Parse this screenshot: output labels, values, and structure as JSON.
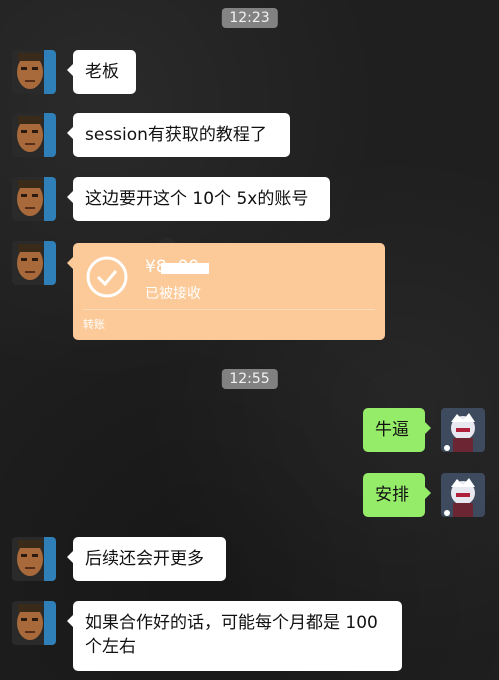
{
  "chat": {
    "time_1": "12:23",
    "time_2": "12:55",
    "messages": [
      {
        "text": "老板"
      },
      {
        "text": "session有获取的教程了"
      },
      {
        "text": "这边要开这个 10个 5x的账号"
      },
      {
        "text": "牛逼"
      },
      {
        "text": "安排"
      },
      {
        "text": "后续还会开更多"
      },
      {
        "text": "如果合作好的话，可能每个月都是 100个左右"
      }
    ],
    "transfer": {
      "amount": "¥8     .00",
      "status": "已被接收",
      "label": "转账"
    }
  },
  "colors": {
    "background": "#1f1f1f",
    "incoming_bubble": "#ffffff",
    "outgoing_bubble": "#95ec69",
    "transfer_bubble": "#fcc998"
  },
  "icons": {
    "boss_avatar": "portrait-avatar",
    "my_avatar": "anime-avatar",
    "transfer_check": "check-circle-icon"
  }
}
